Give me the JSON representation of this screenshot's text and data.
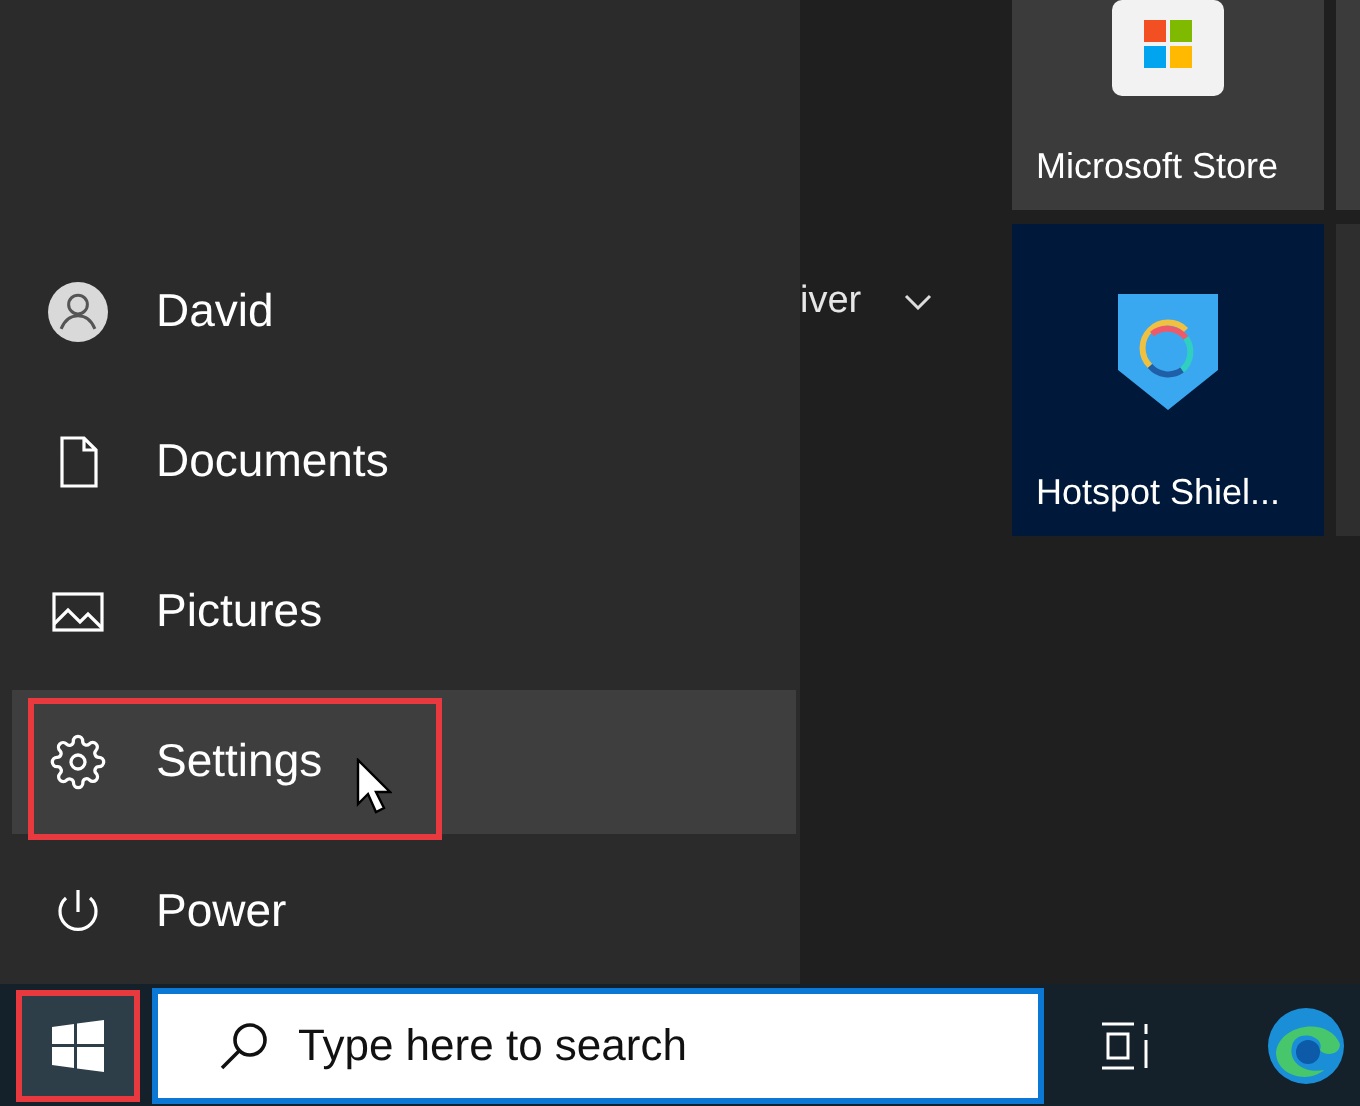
{
  "menu": {
    "items": [
      {
        "kind": "user",
        "label": "David",
        "highlighted": false,
        "outlined": false
      },
      {
        "kind": "documents",
        "label": "Documents",
        "highlighted": false,
        "outlined": false
      },
      {
        "kind": "pictures",
        "label": "Pictures",
        "highlighted": false,
        "outlined": false
      },
      {
        "kind": "settings",
        "label": "Settings",
        "highlighted": true,
        "outlined": true
      },
      {
        "kind": "power",
        "label": "Power",
        "highlighted": false,
        "outlined": false
      }
    ]
  },
  "app_group": {
    "label": "iver",
    "expanded": false
  },
  "tiles": [
    {
      "kind": "store",
      "label": "Microsoft Store"
    },
    {
      "kind": "vpn",
      "label": "Hotspot Shiel..."
    }
  ],
  "taskbar": {
    "start_button": {
      "outlined": true
    },
    "search": {
      "placeholder": "Type here to search"
    }
  }
}
